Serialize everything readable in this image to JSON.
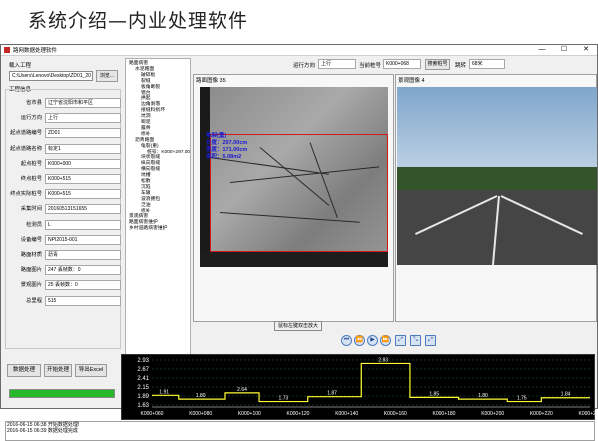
{
  "slide": {
    "title": "系统介绍—内业处理软件"
  },
  "window": {
    "title": "路网数据处理软件",
    "controls": [
      "—",
      "☐",
      "✕"
    ]
  },
  "import": {
    "label": "载入工程",
    "path": "C:\\Users\\Lenovo\\Desktop\\ZD01_20",
    "browse_label": "浏览..."
  },
  "project": {
    "group_label": "工程信息",
    "fields": [
      {
        "key": "省市县",
        "value": "辽宁省沈阳市和平区"
      },
      {
        "key": "运行方向",
        "value": "上行"
      },
      {
        "key": "起点道路编号",
        "value": "ZD01"
      },
      {
        "key": "起点道路名称",
        "value": "标定1"
      },
      {
        "key": "起点桩号",
        "value": "K000+000"
      },
      {
        "key": "终点桩号",
        "value": "K000+515"
      },
      {
        "key": "终点实际桩号",
        "value": "K000+515"
      },
      {
        "key": "采集时间",
        "value": "20160513151655"
      },
      {
        "key": "检测员",
        "value": "L"
      },
      {
        "key": "设备编号",
        "value": "NPI2015-001"
      },
      {
        "key": "路面材质",
        "value": "沥青"
      },
      {
        "key": "路面图片",
        "value": "247   丢帧数：0"
      },
      {
        "key": "景观图片",
        "value": "25   丢帧数：0"
      },
      {
        "key": "总里程",
        "value": "515"
      }
    ]
  },
  "buttons": {
    "process": "数据处理",
    "start": "开始处理",
    "export": "导出Excel"
  },
  "progress": {
    "fraction": 1.0
  },
  "tree": [
    {
      "text": "路面病害",
      "depth": 0
    },
    {
      "text": "水泥路面",
      "depth": 1
    },
    {
      "text": "破碎板",
      "depth": 2
    },
    {
      "text": "裂缝",
      "depth": 2
    },
    {
      "text": "板角断裂",
      "depth": 2
    },
    {
      "text": "错台",
      "depth": 2
    },
    {
      "text": "拱起",
      "depth": 2
    },
    {
      "text": "边角剥落",
      "depth": 2
    },
    {
      "text": "接缝料损坏",
      "depth": 2
    },
    {
      "text": "坑洞",
      "depth": 2
    },
    {
      "text": "唧泥",
      "depth": 2
    },
    {
      "text": "露骨",
      "depth": 2
    },
    {
      "text": "修补",
      "depth": 2
    },
    {
      "text": "沥青路面",
      "depth": 1
    },
    {
      "text": "龟裂(重)",
      "depth": 2
    },
    {
      "text": "桩号：K000+297.00",
      "depth": 3
    },
    {
      "text": "块状裂缝",
      "depth": 2
    },
    {
      "text": "纵向裂缝",
      "depth": 2
    },
    {
      "text": "横向裂缝",
      "depth": 2
    },
    {
      "text": "坑槽",
      "depth": 2
    },
    {
      "text": "松散",
      "depth": 2
    },
    {
      "text": "沉陷",
      "depth": 2
    },
    {
      "text": "车辙",
      "depth": 2
    },
    {
      "text": "波浪拥包",
      "depth": 2
    },
    {
      "text": "泛油",
      "depth": 2
    },
    {
      "text": "修补",
      "depth": 2
    },
    {
      "text": "景观病害",
      "depth": 0
    },
    {
      "text": "路面病害维护",
      "depth": 0
    },
    {
      "text": "乡村道路病害维护",
      "depth": 0
    }
  ],
  "toolbar": {
    "direction_label": "运行方向",
    "direction_value": "上行",
    "station_label": "当前桩号",
    "station_value": "K000+068",
    "search_label": "搜索桩号",
    "jump_label": "跳转",
    "jump_value": "68米"
  },
  "road_panel": {
    "title": "路面图像 35",
    "measure_title": "龟裂(重)",
    "measure_lines": [
      "长度：297.00cm",
      "宽度：171.00cm",
      "面积：5.08m2"
    ],
    "zoom_button": "鼠标左键双击放大"
  },
  "scene_panel": {
    "title": "景观图像 4"
  },
  "media_controls": [
    "⏮",
    "⏪",
    "▶",
    "⏩",
    "⤢",
    "⤡",
    "⤢"
  ],
  "chart_data": {
    "type": "line",
    "categories": [
      "K000+060",
      "K000+080",
      "K000+100",
      "K000+120",
      "K000+140",
      "K000+160",
      "K000+180",
      "K000+200",
      "K000+220",
      "K000+240"
    ],
    "y_ticks": [
      2.93,
      2.67,
      2.41,
      2.15,
      1.89,
      1.63
    ],
    "ylim": [
      1.63,
      2.93
    ],
    "step_points": [
      [
        0,
        1.91
      ],
      [
        0.55,
        1.91
      ],
      [
        0.55,
        1.8
      ],
      [
        1.5,
        1.8
      ],
      [
        1.5,
        1.98
      ],
      [
        2.2,
        1.98
      ],
      [
        2.2,
        1.73
      ],
      [
        3.2,
        1.73
      ],
      [
        3.2,
        1.87
      ],
      [
        4.3,
        1.87
      ],
      [
        4.3,
        2.83
      ],
      [
        5.3,
        2.83
      ],
      [
        5.3,
        1.85
      ],
      [
        6.3,
        1.85
      ],
      [
        6.3,
        1.8
      ],
      [
        7.3,
        1.8
      ],
      [
        7.3,
        1.73
      ],
      [
        8.0,
        1.73
      ],
      [
        8.0,
        1.84
      ],
      [
        9.0,
        1.84
      ]
    ],
    "point_labels": [
      {
        "x": 0.25,
        "y": 1.91,
        "text": "1.91"
      },
      {
        "x": 1.0,
        "y": 1.8,
        "text": "1.80"
      },
      {
        "x": 1.85,
        "y": 1.98,
        "text": "2.64"
      },
      {
        "x": 2.7,
        "y": 1.73,
        "text": "1.73"
      },
      {
        "x": 3.7,
        "y": 1.87,
        "text": "1.87"
      },
      {
        "x": 4.75,
        "y": 2.83,
        "text": "2.83"
      },
      {
        "x": 5.8,
        "y": 1.85,
        "text": "1.85"
      },
      {
        "x": 6.8,
        "y": 1.8,
        "text": "1.80"
      },
      {
        "x": 7.6,
        "y": 1.73,
        "text": "1.75"
      },
      {
        "x": 8.5,
        "y": 1.84,
        "text": "1.84"
      }
    ],
    "grid": true,
    "colors": {
      "line": "#ffff33",
      "grid": "#2a6a2a",
      "axis": "#ffffff",
      "bg": "#000000"
    }
  },
  "log": [
    "2016-06-15 06:38 开始数据处理!",
    "2016-06-15 06:39 数据处理完成"
  ]
}
